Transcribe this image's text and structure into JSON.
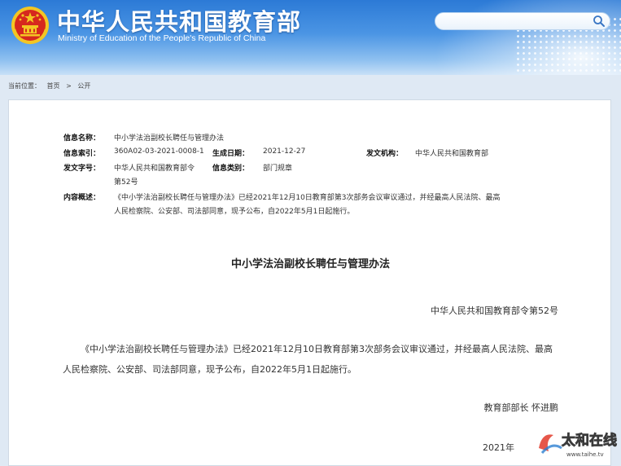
{
  "header": {
    "title": "中华人民共和国教育部",
    "subtitle": "Ministry of Education of the People's Republic of China",
    "search": {
      "placeholder": "",
      "value": ""
    }
  },
  "breadcrumb": {
    "label": "当前位置：",
    "home": "首页",
    "section": "公开"
  },
  "meta": {
    "name_label": "信息名称：",
    "name_value": "中小学法治副校长聘任与管理办法",
    "index_label": "信息索引：",
    "index_value": "360A02-03-2021-0008-1",
    "date_label": "生成日期：",
    "date_value": "2021-12-27",
    "org_label": "发文机构：",
    "org_value": "中华人民共和国教育部",
    "docno_label": "发文字号：",
    "docno_value_line1": "中华人民共和国教育部令",
    "docno_value_line2": "第52号",
    "category_label": "信息类别：",
    "category_value": "部门规章",
    "summary_label": "内容概述：",
    "summary_line1": "《中小学法治副校长聘任与管理办法》已经2021年12月10日教育部第3次部务会议审议通过，并经最高人民法院、最高",
    "summary_line2": "人民检察院、公安部、司法部同意，现予公布，自2022年5月1日起施行。"
  },
  "article": {
    "title": "中小学法治副校长聘任与管理办法",
    "order_no": "中华人民共和国教育部令第52号",
    "paragraph": "《中小学法治副校长聘任与管理办法》已经2021年12月10日教育部第3次部务会议审议通过，并经最高人民法院、最高人民检察院、公安部、司法部同意，现予公布，自2022年5月1日起施行。",
    "signature": "教育部部长  怀进鹏",
    "date_partial": "2021年"
  },
  "watermark": {
    "text": "太和在线",
    "url": "www.taihe.tv"
  },
  "colors": {
    "header_blue": "#2c7ad6",
    "emblem_red": "#d6281e",
    "emblem_gold": "#f3c623"
  },
  "icons": {
    "emblem": "national-emblem-icon",
    "search": "search-icon"
  }
}
